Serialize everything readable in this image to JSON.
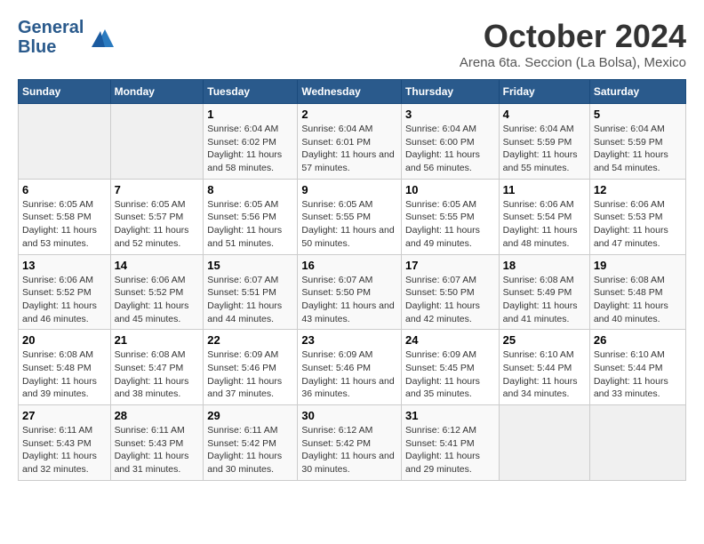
{
  "header": {
    "logo_line1": "General",
    "logo_line2": "Blue",
    "month": "October 2024",
    "location": "Arena 6ta. Seccion (La Bolsa), Mexico"
  },
  "weekdays": [
    "Sunday",
    "Monday",
    "Tuesday",
    "Wednesday",
    "Thursday",
    "Friday",
    "Saturday"
  ],
  "weeks": [
    [
      {
        "day": "",
        "info": ""
      },
      {
        "day": "",
        "info": ""
      },
      {
        "day": "1",
        "info": "Sunrise: 6:04 AM\nSunset: 6:02 PM\nDaylight: 11 hours and 58 minutes."
      },
      {
        "day": "2",
        "info": "Sunrise: 6:04 AM\nSunset: 6:01 PM\nDaylight: 11 hours and 57 minutes."
      },
      {
        "day": "3",
        "info": "Sunrise: 6:04 AM\nSunset: 6:00 PM\nDaylight: 11 hours and 56 minutes."
      },
      {
        "day": "4",
        "info": "Sunrise: 6:04 AM\nSunset: 5:59 PM\nDaylight: 11 hours and 55 minutes."
      },
      {
        "day": "5",
        "info": "Sunrise: 6:04 AM\nSunset: 5:59 PM\nDaylight: 11 hours and 54 minutes."
      }
    ],
    [
      {
        "day": "6",
        "info": "Sunrise: 6:05 AM\nSunset: 5:58 PM\nDaylight: 11 hours and 53 minutes."
      },
      {
        "day": "7",
        "info": "Sunrise: 6:05 AM\nSunset: 5:57 PM\nDaylight: 11 hours and 52 minutes."
      },
      {
        "day": "8",
        "info": "Sunrise: 6:05 AM\nSunset: 5:56 PM\nDaylight: 11 hours and 51 minutes."
      },
      {
        "day": "9",
        "info": "Sunrise: 6:05 AM\nSunset: 5:55 PM\nDaylight: 11 hours and 50 minutes."
      },
      {
        "day": "10",
        "info": "Sunrise: 6:05 AM\nSunset: 5:55 PM\nDaylight: 11 hours and 49 minutes."
      },
      {
        "day": "11",
        "info": "Sunrise: 6:06 AM\nSunset: 5:54 PM\nDaylight: 11 hours and 48 minutes."
      },
      {
        "day": "12",
        "info": "Sunrise: 6:06 AM\nSunset: 5:53 PM\nDaylight: 11 hours and 47 minutes."
      }
    ],
    [
      {
        "day": "13",
        "info": "Sunrise: 6:06 AM\nSunset: 5:52 PM\nDaylight: 11 hours and 46 minutes."
      },
      {
        "day": "14",
        "info": "Sunrise: 6:06 AM\nSunset: 5:52 PM\nDaylight: 11 hours and 45 minutes."
      },
      {
        "day": "15",
        "info": "Sunrise: 6:07 AM\nSunset: 5:51 PM\nDaylight: 11 hours and 44 minutes."
      },
      {
        "day": "16",
        "info": "Sunrise: 6:07 AM\nSunset: 5:50 PM\nDaylight: 11 hours and 43 minutes."
      },
      {
        "day": "17",
        "info": "Sunrise: 6:07 AM\nSunset: 5:50 PM\nDaylight: 11 hours and 42 minutes."
      },
      {
        "day": "18",
        "info": "Sunrise: 6:08 AM\nSunset: 5:49 PM\nDaylight: 11 hours and 41 minutes."
      },
      {
        "day": "19",
        "info": "Sunrise: 6:08 AM\nSunset: 5:48 PM\nDaylight: 11 hours and 40 minutes."
      }
    ],
    [
      {
        "day": "20",
        "info": "Sunrise: 6:08 AM\nSunset: 5:48 PM\nDaylight: 11 hours and 39 minutes."
      },
      {
        "day": "21",
        "info": "Sunrise: 6:08 AM\nSunset: 5:47 PM\nDaylight: 11 hours and 38 minutes."
      },
      {
        "day": "22",
        "info": "Sunrise: 6:09 AM\nSunset: 5:46 PM\nDaylight: 11 hours and 37 minutes."
      },
      {
        "day": "23",
        "info": "Sunrise: 6:09 AM\nSunset: 5:46 PM\nDaylight: 11 hours and 36 minutes."
      },
      {
        "day": "24",
        "info": "Sunrise: 6:09 AM\nSunset: 5:45 PM\nDaylight: 11 hours and 35 minutes."
      },
      {
        "day": "25",
        "info": "Sunrise: 6:10 AM\nSunset: 5:44 PM\nDaylight: 11 hours and 34 minutes."
      },
      {
        "day": "26",
        "info": "Sunrise: 6:10 AM\nSunset: 5:44 PM\nDaylight: 11 hours and 33 minutes."
      }
    ],
    [
      {
        "day": "27",
        "info": "Sunrise: 6:11 AM\nSunset: 5:43 PM\nDaylight: 11 hours and 32 minutes."
      },
      {
        "day": "28",
        "info": "Sunrise: 6:11 AM\nSunset: 5:43 PM\nDaylight: 11 hours and 31 minutes."
      },
      {
        "day": "29",
        "info": "Sunrise: 6:11 AM\nSunset: 5:42 PM\nDaylight: 11 hours and 30 minutes."
      },
      {
        "day": "30",
        "info": "Sunrise: 6:12 AM\nSunset: 5:42 PM\nDaylight: 11 hours and 30 minutes."
      },
      {
        "day": "31",
        "info": "Sunrise: 6:12 AM\nSunset: 5:41 PM\nDaylight: 11 hours and 29 minutes."
      },
      {
        "day": "",
        "info": ""
      },
      {
        "day": "",
        "info": ""
      }
    ]
  ]
}
